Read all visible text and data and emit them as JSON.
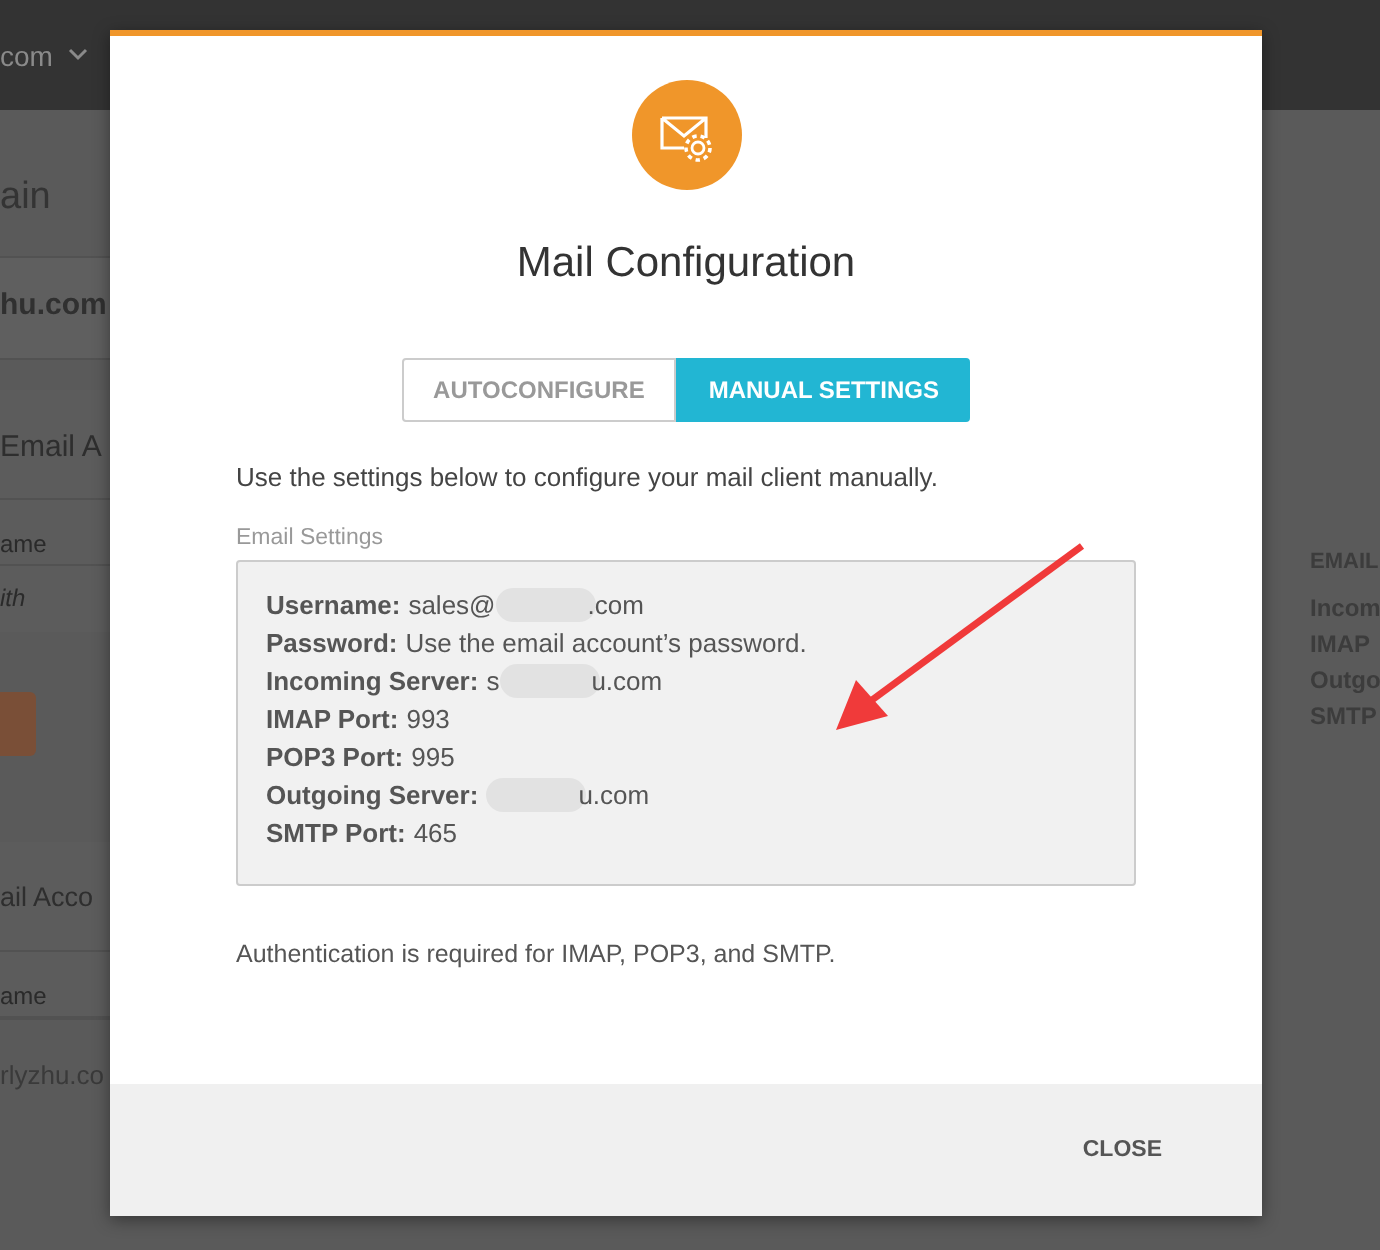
{
  "background": {
    "top_bar_text": "com",
    "left_items": [
      {
        "kind": "heading",
        "text": "ain"
      },
      {
        "kind": "domain",
        "text": "hu.com"
      },
      {
        "kind": "panel_heading",
        "text": "Email A"
      },
      {
        "kind": "label",
        "text": "ame"
      },
      {
        "kind": "placeholder",
        "text": "ith"
      },
      {
        "kind": "button"
      },
      {
        "kind": "panel_heading",
        "text": "ail Acco"
      },
      {
        "kind": "label",
        "text": "ame"
      },
      {
        "kind": "value",
        "text": "rlyzhu.co"
      }
    ],
    "right_items": [
      {
        "kind": "heading",
        "text": "EMAIL"
      },
      {
        "kind": "line",
        "text": "Incom"
      },
      {
        "kind": "line",
        "text": "IMAP"
      },
      {
        "kind": "line",
        "text": "Outgo"
      },
      {
        "kind": "line",
        "text": "SMTP"
      }
    ]
  },
  "modal": {
    "title": "Mail Configuration",
    "tabs": [
      {
        "label": "AUTOCONFIGURE",
        "selected": false
      },
      {
        "label": "MANUAL SETTINGS",
        "selected": true
      }
    ],
    "description": "Use the settings below to configure your mail client manually.",
    "settings_label": "Email Settings",
    "settings": [
      {
        "label": "Username:",
        "before": "sales@",
        "after": ".com",
        "redacted": true
      },
      {
        "label": "Password:",
        "before": "Use the email account’s password.",
        "redacted": false
      },
      {
        "label": "Incoming Server:",
        "before": "s",
        "after": "u.com",
        "redacted": true
      },
      {
        "label": "IMAP Port:",
        "before": "993",
        "redacted": false
      },
      {
        "label": "POP3 Port:",
        "before": "995",
        "redacted": false
      },
      {
        "label": "Outgoing Server:",
        "after": "u.com",
        "redacted": true
      },
      {
        "label": "SMTP Port:",
        "before": "465",
        "redacted": false
      }
    ],
    "note": "Authentication is required for IMAP, POP3, and SMTP.",
    "close_button": "CLOSE"
  },
  "annotation": {
    "kind": "arrow"
  }
}
